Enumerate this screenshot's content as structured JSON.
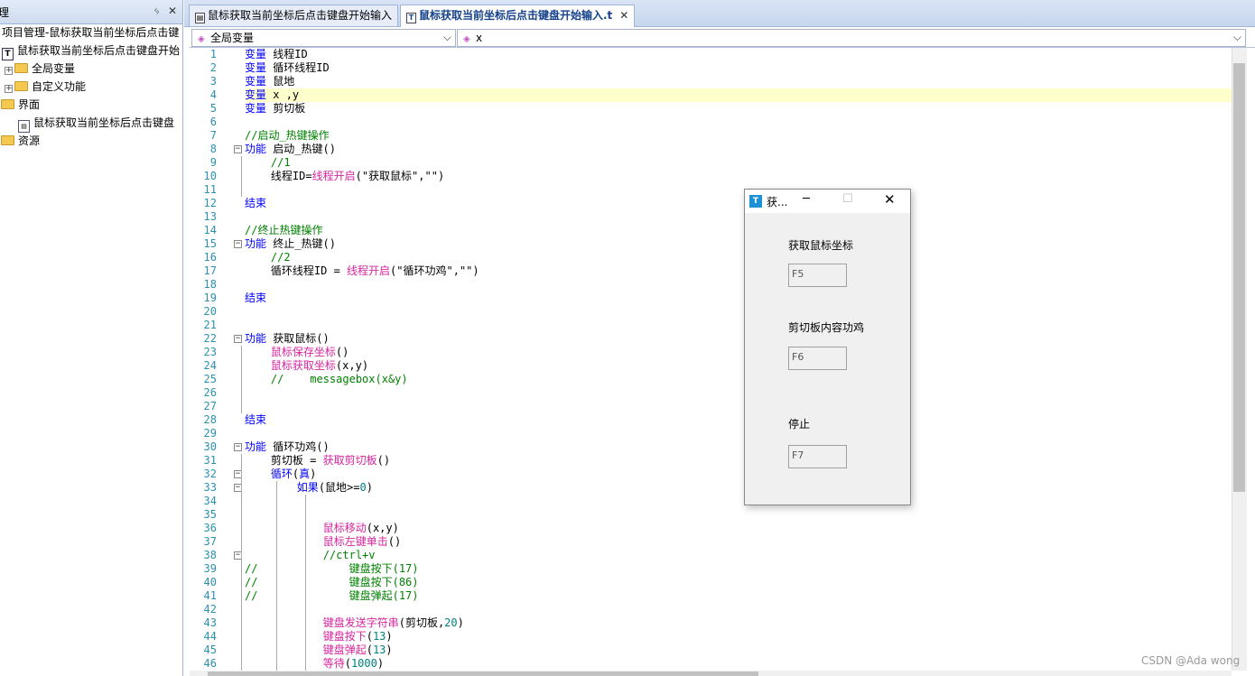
{
  "project_panel": {
    "title": "理",
    "pin": "ᛃ",
    "close": "✕",
    "nodes": [
      {
        "label": "项目管理-鼠标获取当前坐标后点击键",
        "icon": "none"
      },
      {
        "label": "鼠标获取当前坐标后点击键盘开始",
        "icon": "file"
      },
      {
        "label": "全局变量",
        "icon": "folder",
        "expand": "+"
      },
      {
        "label": "自定义功能",
        "icon": "folder",
        "expand": "+"
      },
      {
        "label": "界面",
        "icon": "folder"
      },
      {
        "label": "鼠标获取当前坐标后点击键盘",
        "icon": "form"
      },
      {
        "label": "资源",
        "icon": "folder"
      }
    ]
  },
  "tabs": [
    {
      "label": "鼠标获取当前坐标后点击键盘开始输入"
    },
    {
      "label": "鼠标获取当前坐标后点击键盘开始输入.t",
      "close": "✕"
    }
  ],
  "combos": {
    "left": "全局变量",
    "right": "x"
  },
  "code_lines": [
    [
      [
        "变量",
        "kw"
      ],
      [
        " 线程ID",
        ""
      ]
    ],
    [
      [
        "变量",
        "kw"
      ],
      [
        " 循环线程ID",
        ""
      ]
    ],
    [
      [
        "变量",
        "kw"
      ],
      [
        " 鼠地",
        ""
      ]
    ],
    [
      [
        "变量",
        "kw"
      ],
      [
        " x ,y",
        ""
      ]
    ],
    [
      [
        "变量",
        "kw"
      ],
      [
        " 剪切板",
        ""
      ]
    ],
    [],
    [
      [
        "//启动_热键操作",
        "cm"
      ]
    ],
    [
      [
        "功能",
        "kw"
      ],
      [
        " 启动_热键()",
        ""
      ]
    ],
    [
      [
        "    //1",
        "cm"
      ]
    ],
    [
      [
        "    线程ID=",
        ""
      ],
      [
        "线程开启",
        "fn"
      ],
      [
        "(\"获取鼠标\",\"\")",
        ""
      ]
    ],
    [],
    [
      [
        "结束",
        "kw"
      ]
    ],
    [],
    [
      [
        "//终止热键操作",
        "cm"
      ]
    ],
    [
      [
        "功能",
        "kw"
      ],
      [
        " 终止_热键()",
        ""
      ]
    ],
    [
      [
        "    //2",
        "cm"
      ]
    ],
    [
      [
        "    循环线程ID = ",
        ""
      ],
      [
        "线程开启",
        "fn"
      ],
      [
        "(\"循环功鸡\",\"\")",
        ""
      ]
    ],
    [],
    [
      [
        "结束",
        "kw"
      ]
    ],
    [],
    [],
    [
      [
        "功能",
        "kw"
      ],
      [
        " 获取鼠标()",
        ""
      ]
    ],
    [
      [
        "    ",
        ""
      ],
      [
        "鼠标保存坐标",
        "fn"
      ],
      [
        "()",
        ""
      ]
    ],
    [
      [
        "    ",
        ""
      ],
      [
        "鼠标获取坐标",
        "fn"
      ],
      [
        "(x,y)",
        ""
      ]
    ],
    [
      [
        "    //    messagebox(x&y)",
        "cm"
      ]
    ],
    [],
    [],
    [
      [
        "结束",
        "kw"
      ]
    ],
    [],
    [
      [
        "功能",
        "kw"
      ],
      [
        " 循环功鸡()",
        ""
      ]
    ],
    [
      [
        "    剪切板 = ",
        ""
      ],
      [
        "获取剪切板",
        "fn"
      ],
      [
        "()",
        ""
      ]
    ],
    [
      [
        "    ",
        ""
      ],
      [
        "循环",
        "kw"
      ],
      [
        "(",
        ""
      ],
      [
        "真",
        "kw"
      ],
      [
        ")",
        ""
      ]
    ],
    [
      [
        "        ",
        ""
      ],
      [
        "如果",
        "kw"
      ],
      [
        "(鼠地>=",
        ""
      ],
      [
        "0",
        "num"
      ],
      [
        ")",
        ""
      ]
    ],
    [],
    [],
    [
      [
        "            ",
        ""
      ],
      [
        "鼠标移动",
        "fn"
      ],
      [
        "(x,y)",
        ""
      ]
    ],
    [
      [
        "            ",
        ""
      ],
      [
        "鼠标左键单击",
        "fn"
      ],
      [
        "()",
        ""
      ]
    ],
    [
      [
        "            //ctrl+v",
        "cm"
      ]
    ],
    [
      [
        "//              键盘按下(17)",
        "cm"
      ]
    ],
    [
      [
        "//              键盘按下(86)",
        "cm"
      ]
    ],
    [
      [
        "//              键盘弹起(17)",
        "cm"
      ]
    ],
    [],
    [
      [
        "            ",
        ""
      ],
      [
        "键盘发送字符串",
        "fn"
      ],
      [
        "(剪切板,",
        ""
      ],
      [
        "20",
        "num"
      ],
      [
        ")",
        ""
      ]
    ],
    [
      [
        "            ",
        ""
      ],
      [
        "键盘按下",
        "fn"
      ],
      [
        "(",
        ""
      ],
      [
        "13",
        "num"
      ],
      [
        ")",
        ""
      ]
    ],
    [
      [
        "            ",
        ""
      ],
      [
        "键盘弹起",
        "fn"
      ],
      [
        "(",
        ""
      ],
      [
        "13",
        "num"
      ],
      [
        ")",
        ""
      ]
    ],
    [
      [
        "            ",
        ""
      ],
      [
        "等待",
        "fn"
      ],
      [
        "(",
        ""
      ],
      [
        "1000",
        "num"
      ],
      [
        ")",
        ""
      ]
    ]
  ],
  "fold_lines": [
    8,
    15,
    22,
    30,
    32,
    33,
    38
  ],
  "dialog": {
    "title": "获...",
    "minimize": "─",
    "maximize": "☐",
    "close": "✕",
    "fields": [
      {
        "label": "获取鼠标坐标",
        "value": "F5"
      },
      {
        "label": "剪切板内容功鸡",
        "value": "F6"
      },
      {
        "label": "停止",
        "value": "F7"
      }
    ]
  },
  "watermark": "CSDN @Ada wong",
  "colors": {
    "keyword": "#0000ff",
    "comment": "#008000",
    "function": "#d7249e",
    "number": "#008080",
    "line_number": "#2b91af",
    "current_line": "#ffffcc"
  }
}
